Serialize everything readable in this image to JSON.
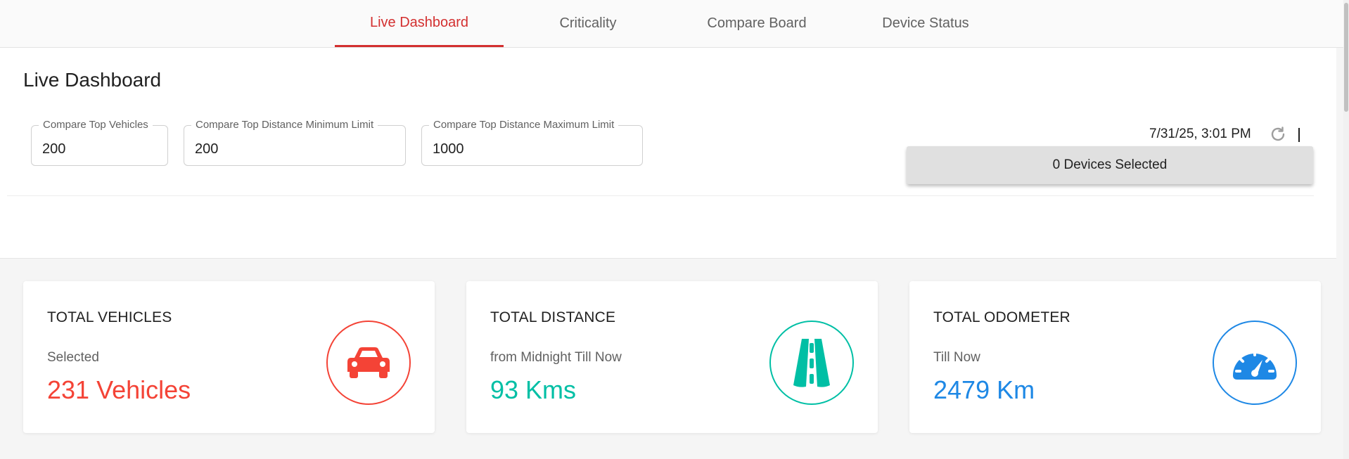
{
  "tabs": [
    {
      "label": "Live Dashboard",
      "active": true
    },
    {
      "label": "Criticality",
      "active": false
    },
    {
      "label": "Compare Board",
      "active": false
    },
    {
      "label": "Device Status",
      "active": false
    }
  ],
  "page": {
    "title": "Live Dashboard"
  },
  "filters": {
    "top_vehicles": {
      "label": "Compare Top Vehicles",
      "value": "200"
    },
    "min_limit": {
      "label": "Compare Top Distance Minimum Limit",
      "value": "200"
    },
    "max_limit": {
      "label": "Compare Top Distance Maximum Limit",
      "value": "1000"
    }
  },
  "toolbar": {
    "timestamp": "7/31/25, 3:01 PM",
    "refresh_icon": "refresh-icon",
    "devices_label": "0 Devices Selected"
  },
  "cards": [
    {
      "title": "TOTAL VEHICLES",
      "subtitle": "Selected",
      "value": "231 Vehicles",
      "icon": "car-icon",
      "color": "#f44336"
    },
    {
      "title": "TOTAL DISTANCE",
      "subtitle": "from Midnight Till Now",
      "value": "93 Kms",
      "icon": "road-icon",
      "color": "#00bfa5"
    },
    {
      "title": "TOTAL ODOMETER",
      "subtitle": "Till Now",
      "value": "2479 Km",
      "icon": "speedometer-icon",
      "color": "#1e88e5"
    }
  ]
}
